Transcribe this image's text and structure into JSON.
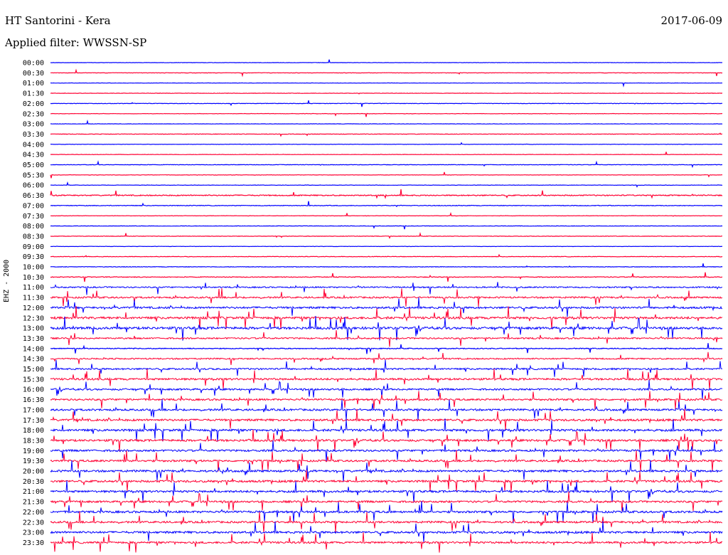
{
  "header": {
    "station": "HT Santorini - Kera",
    "date": "2017-06-09",
    "filter": "Applied filter: WWSSN-SP"
  },
  "channel_label": "EHZ - 2000",
  "colors": {
    "blue": "#0000ff",
    "red": "#ff0033"
  },
  "chart_data": {
    "type": "line",
    "title": "",
    "xlabel": "",
    "ylabel": "EHZ - 2000",
    "row_labels": [
      "00:00",
      "00:30",
      "01:00",
      "01:30",
      "02:00",
      "02:30",
      "03:00",
      "03:30",
      "04:00",
      "04:30",
      "05:00",
      "05:30",
      "06:00",
      "06:30",
      "07:00",
      "07:30",
      "08:00",
      "08:30",
      "09:00",
      "09:30",
      "10:00",
      "10:30",
      "11:00",
      "11:30",
      "12:00",
      "12:30",
      "13:00",
      "13:30",
      "14:00",
      "14:30",
      "15:00",
      "15:30",
      "16:00",
      "16:30",
      "17:00",
      "17:30",
      "18:00",
      "18:30",
      "19:00",
      "19:30",
      "20:00",
      "20:30",
      "21:00",
      "21:30",
      "22:00",
      "22:30",
      "23:00",
      "23:30"
    ],
    "row_colors": [
      "blue",
      "red"
    ],
    "x_range_minutes": [
      0,
      30
    ],
    "activity_level": [
      0.02,
      0.05,
      0.02,
      0.02,
      0.05,
      0.03,
      0.02,
      0.06,
      0.03,
      0.02,
      0.06,
      0.03,
      0.03,
      0.25,
      0.12,
      0.02,
      0.03,
      0.05,
      0.02,
      0.08,
      0.08,
      0.15,
      0.35,
      0.45,
      0.55,
      0.65,
      0.7,
      0.4,
      0.2,
      0.35,
      0.45,
      0.55,
      0.5,
      0.5,
      0.55,
      0.6,
      0.65,
      0.6,
      0.55,
      0.55,
      0.6,
      0.6,
      0.6,
      0.55,
      0.6,
      0.55,
      0.6,
      0.55
    ],
    "grid": false
  }
}
